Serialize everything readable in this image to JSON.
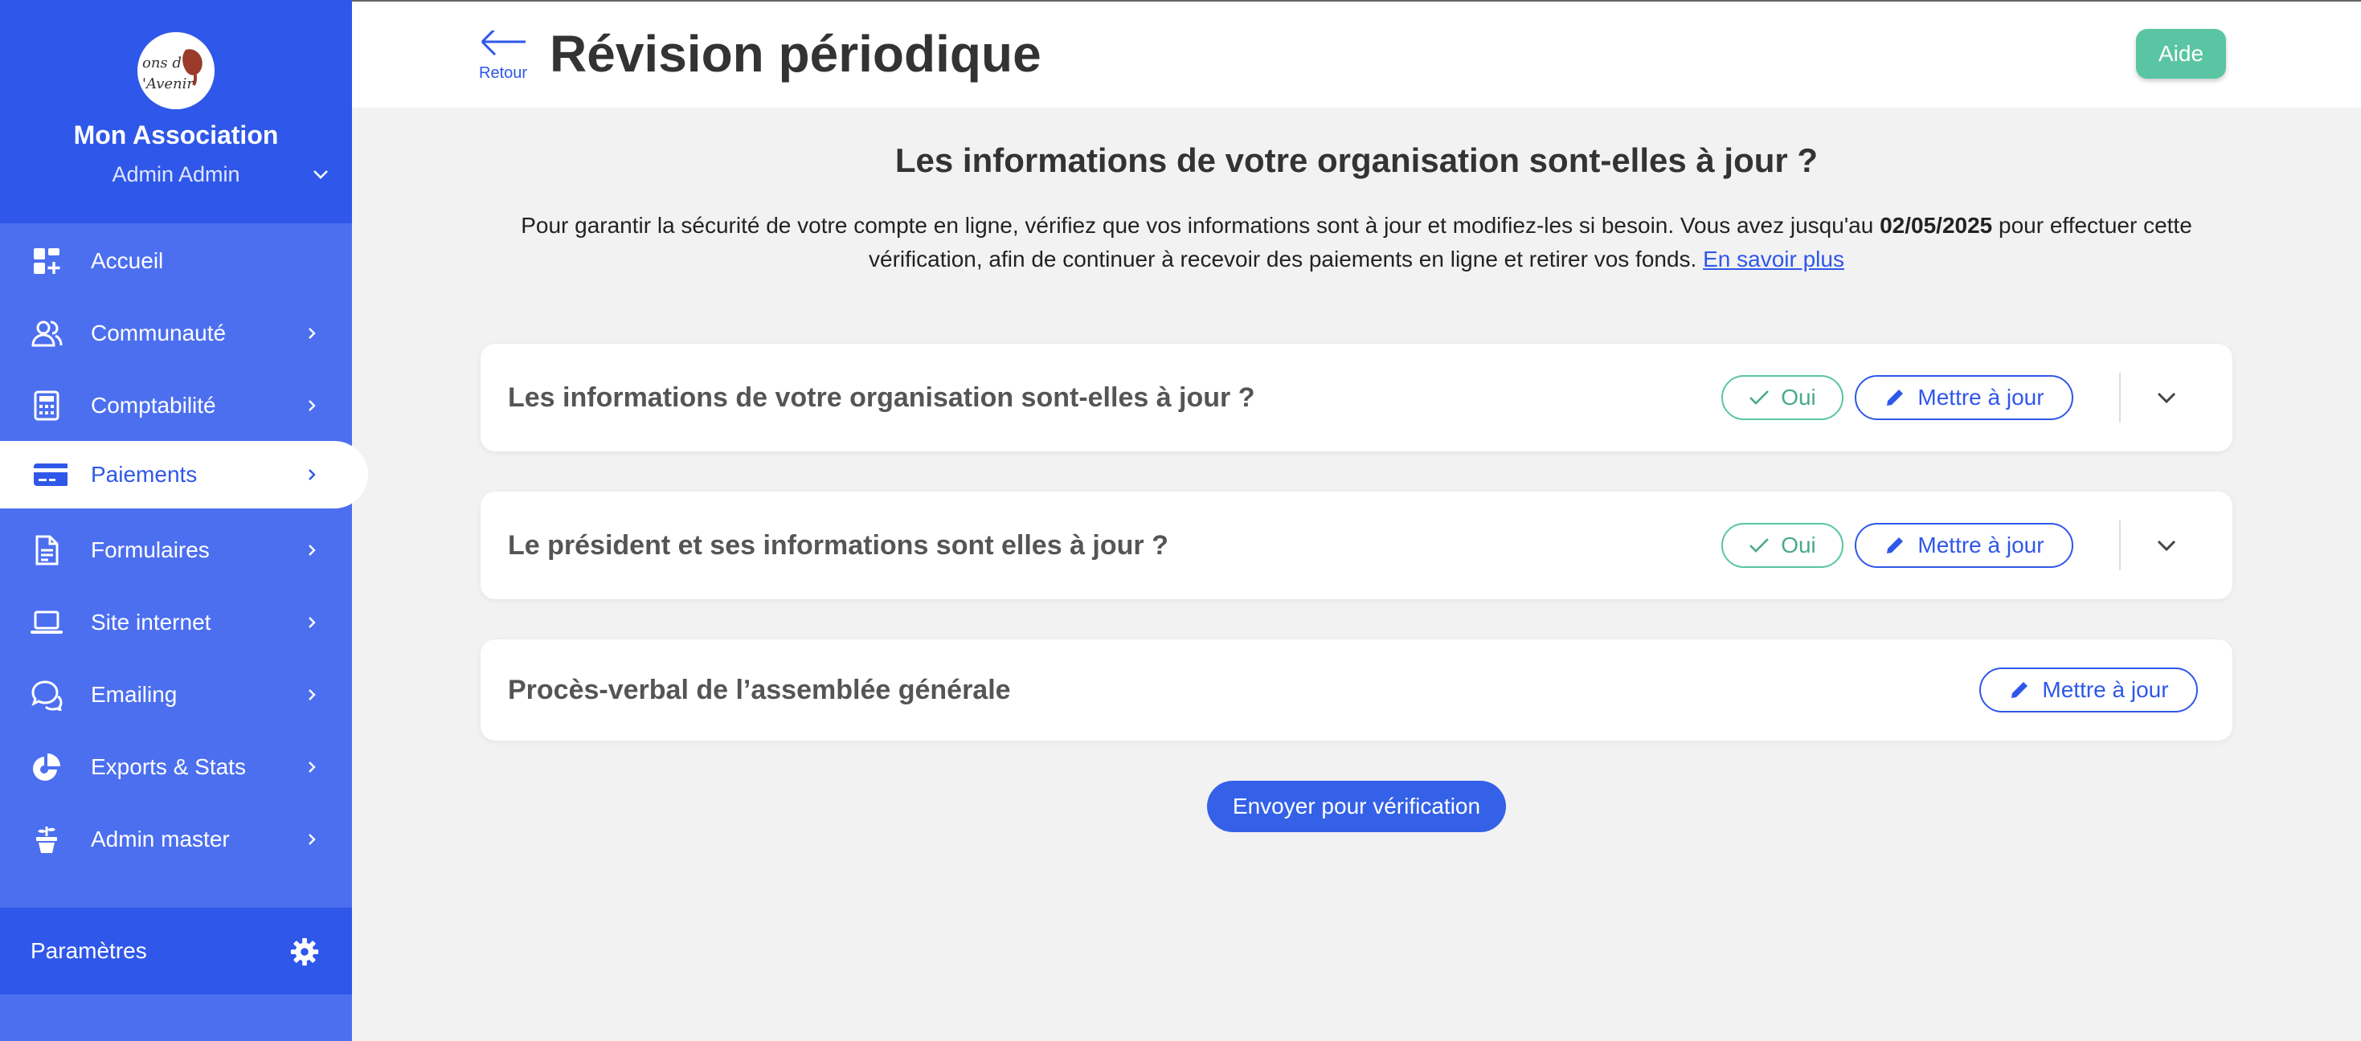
{
  "sidebar": {
    "org_name": "Mon Association",
    "user_name": "Admin Admin",
    "logo_text": "Dons d'Avenir",
    "items": [
      {
        "label": "Accueil",
        "icon": "dashboard-icon"
      },
      {
        "label": "Communauté",
        "icon": "users-icon"
      },
      {
        "label": "Comptabilité",
        "icon": "calculator-icon"
      },
      {
        "label": "Paiements",
        "icon": "credit-card-icon",
        "active": true
      },
      {
        "label": "Formulaires",
        "icon": "document-icon"
      },
      {
        "label": "Site internet",
        "icon": "laptop-icon"
      },
      {
        "label": "Emailing",
        "icon": "chat-bubbles-icon"
      },
      {
        "label": "Exports & Stats",
        "icon": "pie-chart-icon"
      },
      {
        "label": "Admin master",
        "icon": "plant-pot-icon"
      }
    ],
    "settings_label": "Paramètres"
  },
  "header": {
    "back_label": "Retour",
    "title": "Révision périodique",
    "help_label": "Aide"
  },
  "main": {
    "heading": "Les informations de votre organisation sont-elles à jour ?",
    "description_part1": "Pour garantir la sécurité de votre compte en ligne, vérifiez que vos informations sont à jour et modifiez-les si besoin. Vous avez jusqu'au ",
    "deadline": "02/05/2025",
    "description_part2": " pour effectuer cette vérification, afin de continuer à recevoir des paiements en ligne et retirer vos fonds. ",
    "learn_more": "En savoir plus",
    "cards": [
      {
        "title": "Les informations de votre organisation sont-elles à jour ?",
        "yes_label": "Oui",
        "update_label": "Mettre à jour"
      },
      {
        "title": "Le président et ses informations sont elles à jour ?",
        "yes_label": "Oui",
        "update_label": "Mettre à jour"
      },
      {
        "title": "Procès-verbal de l’assemblée générale",
        "update_label": "Mettre à jour"
      }
    ],
    "submit_label": "Envoyer pour vérification"
  },
  "colors": {
    "primary": "#2f57e9",
    "sidebar": "#4c6ff0",
    "success": "#5ac5a3",
    "background": "#f2f2f2"
  }
}
